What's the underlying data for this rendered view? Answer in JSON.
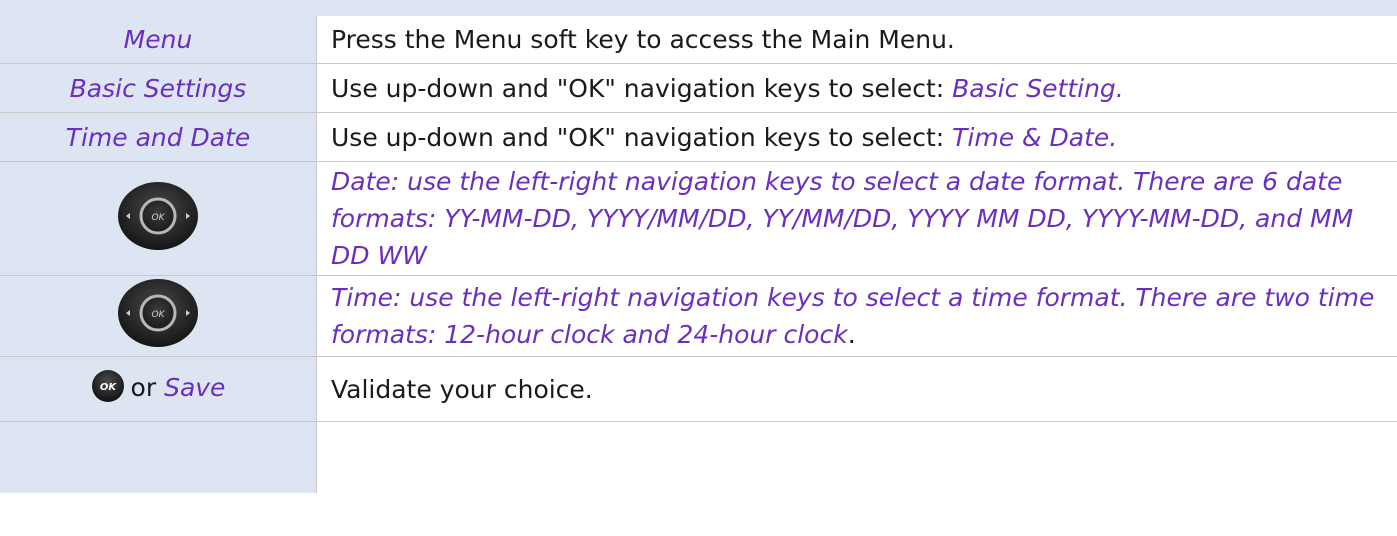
{
  "rows": [
    {
      "key_label": "Menu",
      "description": "Press the Menu soft key to access the Main Menu."
    },
    {
      "key_label": "Basic Settings",
      "description": "Use up-down and \"OK\" navigation keys to select: ",
      "description_em": "Basic Setting."
    },
    {
      "key_label": "Time and Date",
      "description": "Use up-down and \"OK\" navigation keys to select: ",
      "description_em": "Time & Date."
    },
    {
      "key_icon": "navigation-pad-icon",
      "key_icon_label": "OK",
      "description_em": "Date: use the left-right navigation keys to select a date format. There are 6 date formats: YY-MM-DD, YYYY/MM/DD, YY/MM/DD, YYYY MM DD, YYYY-MM-DD, and MM DD WW"
    },
    {
      "key_icon": "navigation-pad-icon",
      "key_icon_label": "OK",
      "description_em": "Time: use the left-right navigation keys to select a time format. There are two time formats: 12-hour clock and 24-hour clock",
      "description_tail": "."
    },
    {
      "key_icon": "ok-button-icon",
      "key_icon_label": "OK",
      "key_or": "or",
      "key_save": "Save",
      "description": "Validate your choice."
    }
  ],
  "colors": {
    "key_column_bg": "#dde5f2",
    "accent_purple": "#6a2fc0",
    "divider": "#c9c9c9",
    "body_text": "#1a1a1a"
  }
}
